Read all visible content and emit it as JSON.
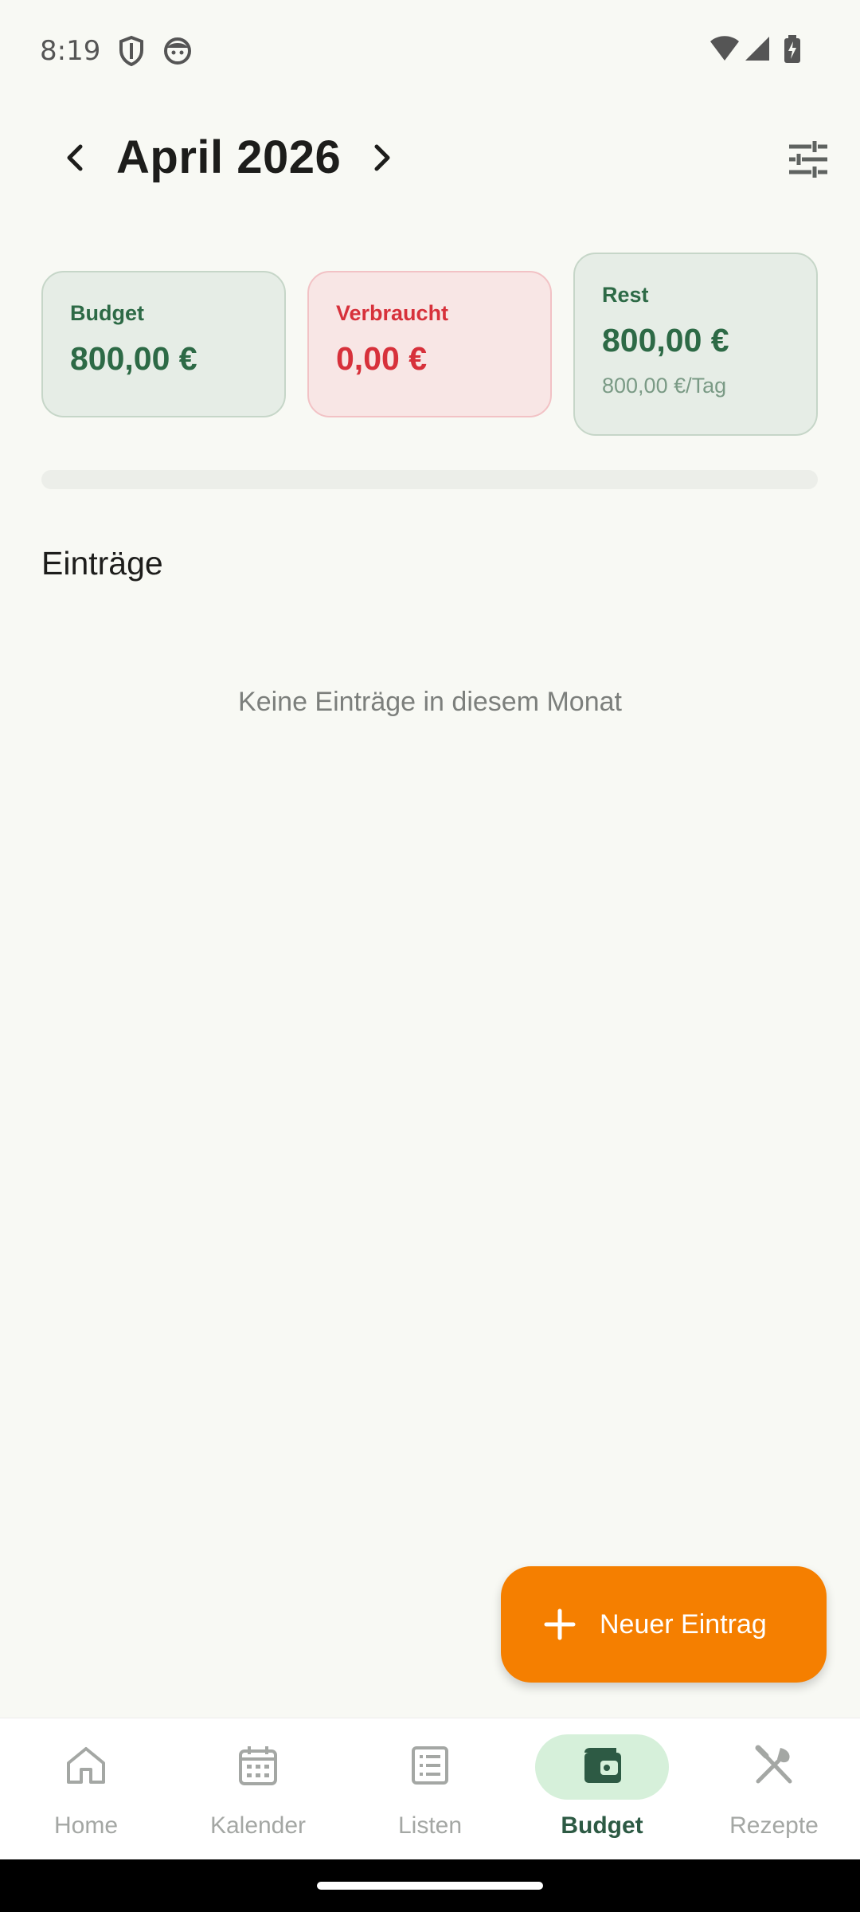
{
  "status_bar": {
    "time": "8:19",
    "icons": [
      "shield-icon",
      "face-icon",
      "wifi-icon",
      "signal-icon",
      "battery-charging-icon"
    ]
  },
  "header": {
    "month_title": "April 2026",
    "icons": [
      "chevron-left-icon",
      "chevron-right-icon",
      "tune-icon"
    ]
  },
  "summary": {
    "budget": {
      "label": "Budget",
      "value": "800,00 €"
    },
    "spent": {
      "label": "Verbraucht",
      "value": "0,00 €"
    },
    "rest": {
      "label": "Rest",
      "value": "800,00 €",
      "per_day": "800,00 €/Tag"
    }
  },
  "progress": {
    "fraction_used": 0
  },
  "entries": {
    "heading": "Einträge",
    "empty_message": "Keine Einträge in diesem Monat"
  },
  "fab": {
    "label": "Neuer Eintrag",
    "icon": "plus-icon"
  },
  "bottom_nav": {
    "items": [
      {
        "label": "Home",
        "icon": "home-icon",
        "active": false
      },
      {
        "label": "Kalender",
        "icon": "calendar-icon",
        "active": false
      },
      {
        "label": "Listen",
        "icon": "list-icon",
        "active": false
      },
      {
        "label": "Budget",
        "icon": "wallet-icon",
        "active": true
      },
      {
        "label": "Rezepte",
        "icon": "utensils-icon",
        "active": false
      }
    ]
  },
  "colors": {
    "background": "#f8f9f4",
    "accent_green": "#2d6a46",
    "accent_red": "#d7313b",
    "fab_orange": "#f57f00",
    "active_nav_pill": "#d6f0da"
  }
}
